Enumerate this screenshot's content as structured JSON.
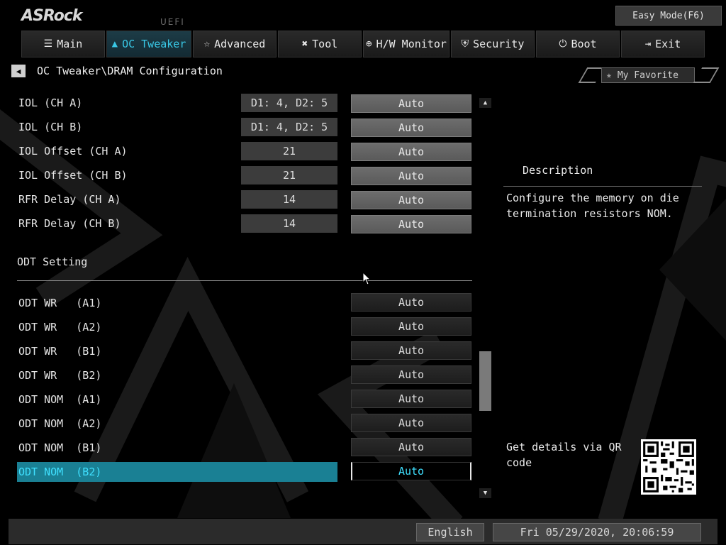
{
  "brand": {
    "logo": "ASRock",
    "sub": "UEFI"
  },
  "header": {
    "easy_mode": "Easy Mode(F6)"
  },
  "tabs": [
    {
      "label": "Main",
      "icon": "list-icon"
    },
    {
      "label": "OC Tweaker",
      "icon": "rocket-icon",
      "active": true
    },
    {
      "label": "Advanced",
      "icon": "star-arrow-icon"
    },
    {
      "label": "Tool",
      "icon": "tools-icon"
    },
    {
      "label": "H/W Monitor",
      "icon": "monitor-icon"
    },
    {
      "label": "Security",
      "icon": "shield-icon"
    },
    {
      "label": "Boot",
      "icon": "power-icon"
    },
    {
      "label": "Exit",
      "icon": "exit-icon"
    }
  ],
  "breadcrumb": {
    "path": "OC Tweaker\\DRAM Configuration"
  },
  "favorite": {
    "label": "My Favorite"
  },
  "settings_top": [
    {
      "label": "IOL (CH A)",
      "current": "D1: 4, D2: 5",
      "value": "Auto"
    },
    {
      "label": "IOL (CH B)",
      "current": "D1: 4, D2: 5",
      "value": "Auto"
    },
    {
      "label": "IOL Offset (CH A)",
      "current": "21",
      "value": "Auto"
    },
    {
      "label": "IOL Offset (CH B)",
      "current": "21",
      "value": "Auto"
    },
    {
      "label": "RFR Delay (CH A)",
      "current": "14",
      "value": "Auto"
    },
    {
      "label": "RFR Delay (CH B)",
      "current": "14",
      "value": "Auto"
    }
  ],
  "section": {
    "title": "ODT Setting"
  },
  "settings_odt": [
    {
      "label": "ODT WR   (A1)",
      "value": "Auto"
    },
    {
      "label": "ODT WR   (A2)",
      "value": "Auto"
    },
    {
      "label": "ODT WR   (B1)",
      "value": "Auto"
    },
    {
      "label": "ODT WR   (B2)",
      "value": "Auto"
    },
    {
      "label": "ODT NOM  (A1)",
      "value": "Auto"
    },
    {
      "label": "ODT NOM  (A2)",
      "value": "Auto"
    },
    {
      "label": "ODT NOM  (B1)",
      "value": "Auto"
    },
    {
      "label": "ODT NOM  (B2)",
      "value": "Auto",
      "selected": true
    }
  ],
  "description": {
    "title": "Description",
    "text": "Configure the memory on die termination resistors NOM."
  },
  "qr": {
    "text": "Get details via QR code"
  },
  "footer": {
    "language": "English",
    "datetime": "Fri 05/29/2020, 20:06:59"
  },
  "colors": {
    "accent": "#39c8e6",
    "selected_bg": "#1a8094"
  }
}
